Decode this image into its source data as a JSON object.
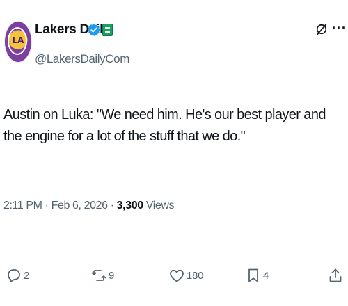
{
  "author": {
    "display_name": "Lakers Daily",
    "handle": "@LakersDailyCom",
    "avatar_icon": "lakers-logo-avatar",
    "verified_color": "#1d9bf0",
    "affiliate_badge_color": "#1aa260"
  },
  "tweet": {
    "text": "Austin on Luka: \"We need him. He's our best player and the engine for a lot of the stuff that we do.\"",
    "time": "2:11 PM",
    "separator": "·",
    "date": "Feb 6, 2026",
    "views_count": "3,300",
    "views_label": "Views"
  },
  "actions": {
    "replies": "2",
    "reposts": "9",
    "likes": "180",
    "bookmarks": "4"
  },
  "colors": {
    "text_primary": "#0f1419",
    "text_secondary": "#536471",
    "divider": "#eff3f4"
  }
}
